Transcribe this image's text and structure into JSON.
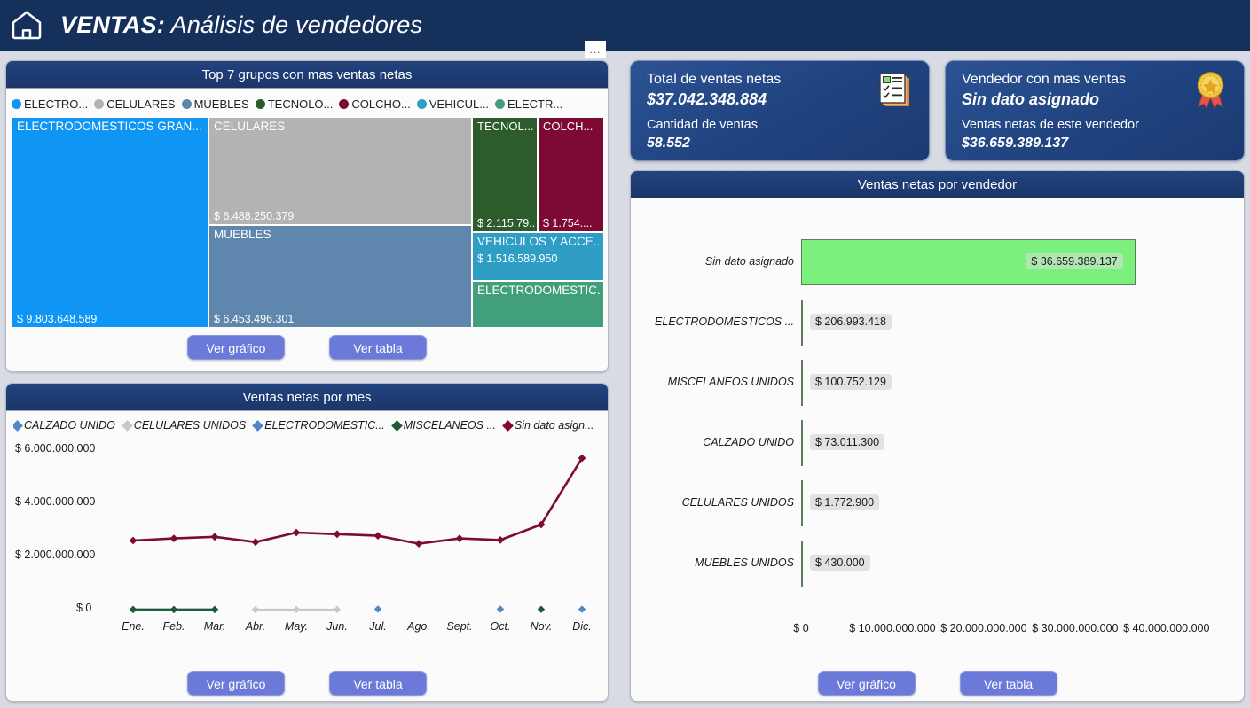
{
  "header": {
    "title_bold": "VENTAS:",
    "title_rest": " Análisis de vendedores",
    "home_icon": "home-icon",
    "menu_label": "..."
  },
  "treemap_panel": {
    "title": "Top 7 grupos con mas ventas netas",
    "legend": [
      {
        "label": "ELECTRO...",
        "color": "#0f96f5"
      },
      {
        "label": "CELULARES",
        "color": "#b3b3b3"
      },
      {
        "label": "MUEBLES",
        "color": "#5f87ad"
      },
      {
        "label": "TECNOLO...",
        "color": "#2c5c2c"
      },
      {
        "label": "COLCHO...",
        "color": "#7d0a35"
      },
      {
        "label": "VEHICUL...",
        "color": "#2e9ec4"
      },
      {
        "label": "ELECTR...",
        "color": "#41a07b"
      }
    ],
    "tiles": [
      {
        "name": "ELECTRODOMESTICOS GRAN...",
        "value": "$ 9.803.648.589",
        "color": "#0f96f5"
      },
      {
        "name": "CELULARES",
        "value": "$ 6.488.250.379",
        "color": "#b3b3b3"
      },
      {
        "name": "MUEBLES",
        "value": "$ 6.453.496.301",
        "color": "#5f87ad"
      },
      {
        "name": "TECNOL...",
        "value": "$ 2.115.79...",
        "color": "#2c5c2c"
      },
      {
        "name": "COLCH...",
        "value": "$ 1.754....",
        "color": "#7d0a35"
      },
      {
        "name": "VEHICULOS Y ACCE...",
        "value": "$ 1.516.589.950",
        "color": "#2e9ec4"
      },
      {
        "name": "ELECTRODOMESTIC...",
        "value": "",
        "color": "#41a07b"
      }
    ],
    "btn_chart": "Ver gráfico",
    "btn_table": "Ver tabla"
  },
  "line_panel": {
    "title": "Ventas netas por mes",
    "btn_chart": "Ver gráfico",
    "btn_table": "Ver tabla"
  },
  "kpi_total": {
    "label1": "Total de ventas netas",
    "value1": "$37.042.348.884",
    "label2": "Cantidad de ventas",
    "value2": "58.552",
    "icon": "checklist-document-icon"
  },
  "kpi_top": {
    "label1": "Vendedor con mas ventas",
    "value1": "Sin dato asignado",
    "label2": "Ventas netas de este vendedor",
    "value2": "$36.659.389.137",
    "icon": "award-medal-icon"
  },
  "bar_panel": {
    "title": "Ventas netas por vendedor",
    "btn_chart": "Ver gráfico",
    "btn_table": "Ver tabla"
  },
  "chart_data": [
    {
      "type": "treemap",
      "title": "Top 7 grupos con mas ventas netas",
      "categories": [
        "ELECTRODOMESTICOS GRAN...",
        "CELULARES",
        "MUEBLES",
        "TECNOL...",
        "COLCH...",
        "VEHICULOS Y ACCE...",
        "ELECTRODOMESTIC..."
      ],
      "values": [
        9803648589,
        6488250379,
        6453496301,
        2115790000,
        1754000000,
        1516589950,
        1200000000
      ],
      "value_labels": [
        "$ 9.803.648.589",
        "$ 6.488.250.379",
        "$ 6.453.496.301",
        "$ 2.115.79...",
        "$ 1.754....",
        "$ 1.516.589.950",
        ""
      ],
      "colors": [
        "#0f96f5",
        "#b3b3b3",
        "#5f87ad",
        "#2c5c2c",
        "#7d0a35",
        "#2e9ec4",
        "#41a07b"
      ],
      "legend_position": "top"
    },
    {
      "type": "line",
      "title": "Ventas netas por mes",
      "xlabel": "",
      "ylabel": "",
      "categories": [
        "Ene.",
        "Feb.",
        "Mar.",
        "Abr.",
        "May.",
        "Jun.",
        "Jul.",
        "Ago.",
        "Sept.",
        "Oct.",
        "Nov.",
        "Dic."
      ],
      "ytick_labels": [
        "$ 0",
        "$ 2.000.000.000",
        "$ 4.000.000.000",
        "$ 6.000.000.000"
      ],
      "ylim": [
        0,
        6000000000
      ],
      "grid": false,
      "legend_position": "top",
      "series": [
        {
          "name": "CALZADO UNIDO",
          "color": "#4f87c8",
          "values": [
            3000000,
            2500000,
            3000000,
            null,
            null,
            null,
            20000000,
            null,
            null,
            18000000,
            null,
            16000000
          ]
        },
        {
          "name": "CELULARES UNIDOS",
          "color": "#c8c8c8",
          "values": [
            null,
            null,
            null,
            1000000,
            900000,
            800000,
            null,
            null,
            null,
            null,
            null,
            null
          ]
        },
        {
          "name": "ELECTRODOMESTIC...",
          "color": "#4f87c8",
          "values": [
            2000000,
            1800000,
            1600000,
            null,
            null,
            null,
            null,
            null,
            null,
            null,
            null,
            null
          ]
        },
        {
          "name": "MISCELANEOS ...",
          "color": "#1d5c33",
          "values": [
            6000000,
            5500000,
            5000000,
            null,
            null,
            null,
            null,
            null,
            null,
            null,
            12000000,
            null
          ]
        },
        {
          "name": "Sin dato asign...",
          "color": "#7d0a35",
          "values": [
            2600000000,
            2680000000,
            2740000000,
            2540000000,
            2900000000,
            2840000000,
            2780000000,
            2480000000,
            2680000000,
            2620000000,
            3200000000,
            5700000000
          ]
        }
      ]
    },
    {
      "type": "bar",
      "orientation": "horizontal",
      "title": "Ventas netas por vendedor",
      "xlabel": "",
      "ylabel": "",
      "categories": [
        "Sin dato asignado",
        "ELECTRODOMESTICOS ...",
        "MISCELANEOS UNIDOS",
        "CALZADO UNIDO",
        "CELULARES UNIDOS",
        "MUEBLES UNIDOS"
      ],
      "values": [
        36659389137,
        206993418,
        100752129,
        73011300,
        1772900,
        430000
      ],
      "value_labels": [
        "$ 36.659.389.137",
        "$ 206.993.418",
        "$ 100.752.129",
        "$ 73.011.300",
        "$ 1.772.900",
        "$ 430.000"
      ],
      "highlight_index": 0,
      "highlight_color": "#7cf07c",
      "bar_color": "#5f7a5f",
      "xlim": [
        0,
        44000000000
      ],
      "xtick_labels": [
        "$ 0",
        "$ 10.000.000.000",
        "$ 20.000.000.000",
        "$ 30.000.000.000",
        "$ 40.000.000.000"
      ],
      "xtick_values": [
        0,
        10000000000,
        20000000000,
        30000000000,
        40000000000
      ],
      "grid": false
    }
  ]
}
